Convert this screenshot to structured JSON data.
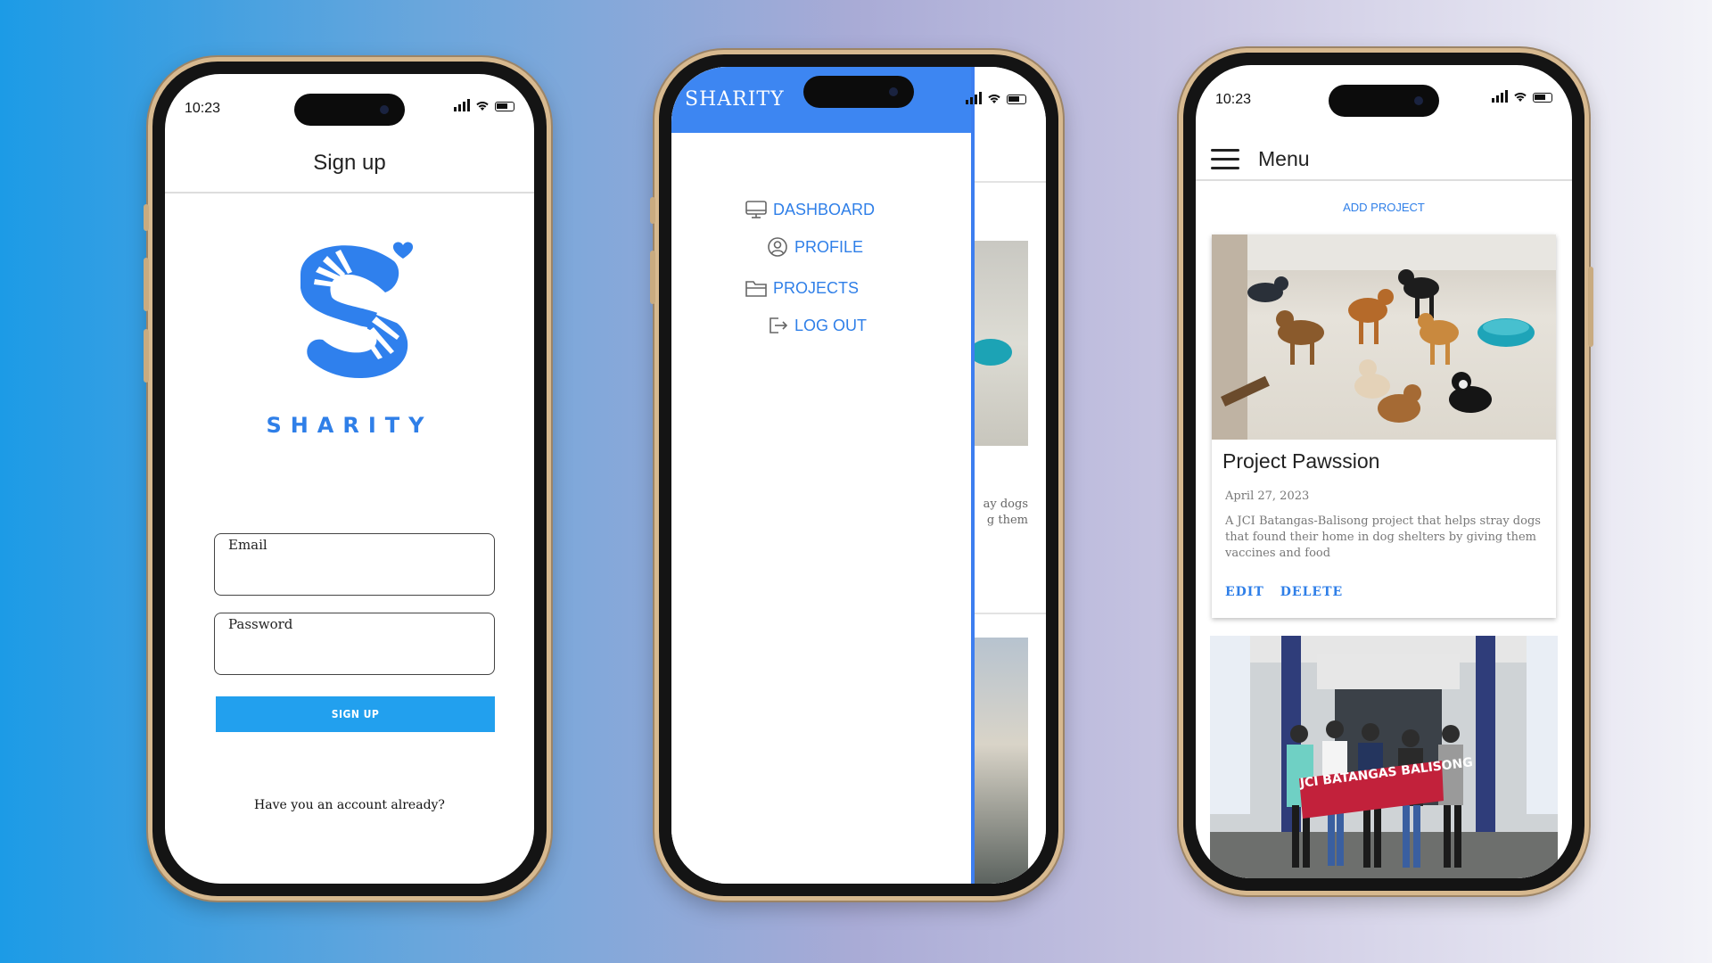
{
  "colors": {
    "accent": "#2f7fe8",
    "signup_button": "#22a0ee",
    "drawer_header": "#3d86f2"
  },
  "status_bar": {
    "time": "10:23"
  },
  "signup_screen": {
    "title": "Sign up",
    "brand": "SHARITY",
    "email_label": "Email",
    "email_value": "",
    "password_label": "Password",
    "password_value": "",
    "signup_button": "SIGN UP",
    "have_account": "Have you an account already?"
  },
  "drawer_screen": {
    "title": "SHARITY",
    "items": [
      {
        "label": "DASHBOARD",
        "icon": "monitor-icon"
      },
      {
        "label": "PROFILE",
        "icon": "user-circle-icon"
      },
      {
        "label": "PROJECTS",
        "icon": "folder-icon"
      },
      {
        "label": "LOG OUT",
        "icon": "logout-icon"
      }
    ],
    "background_card_text": "ay dogs\ng them"
  },
  "menu_screen": {
    "header_title": "Menu",
    "add_project": "ADD PROJECT",
    "projects": [
      {
        "title": "Project Pawssion",
        "date": "April 27, 2023",
        "description": "A JCI Batangas-Balisong project that helps stray dogs that found their home in dog shelters by giving them vaccines and food",
        "edit_label": "EDIT",
        "delete_label": "DELETE"
      }
    ],
    "second_card_banner": "JCI BATANGAS BALISONG"
  }
}
